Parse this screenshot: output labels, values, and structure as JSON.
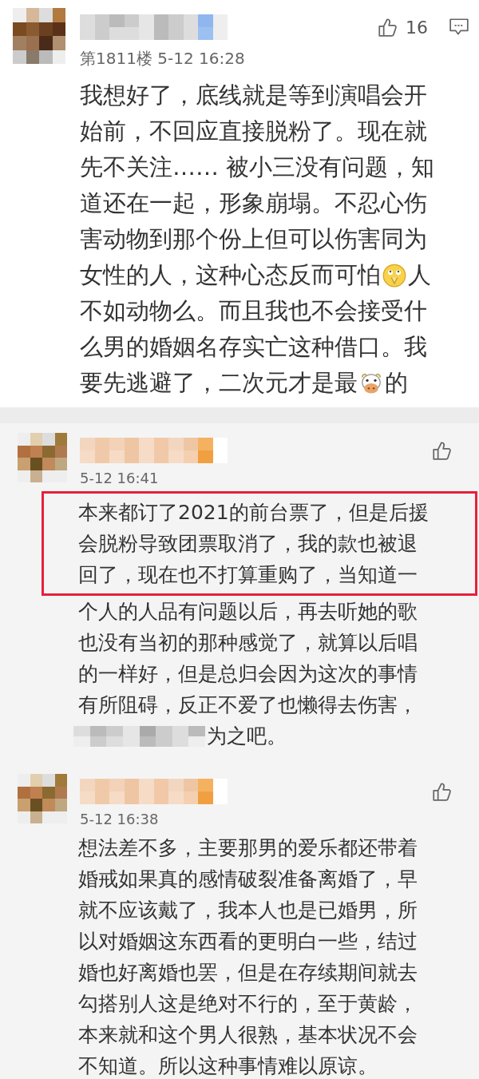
{
  "comments": [
    {
      "meta": "第1811楼 5-12 16:28",
      "like_count": "16",
      "has_reply": true,
      "lines": [
        {
          "highlighted": false,
          "parts": [
            {
              "kind": "text",
              "text": "我想好了，底线就是等到演唱会开"
            }
          ]
        },
        {
          "highlighted": false,
          "parts": [
            {
              "kind": "text",
              "text": "始前，不回应直接脱粉了。现在就"
            }
          ]
        },
        {
          "highlighted": false,
          "parts": [
            {
              "kind": "text",
              "text": "先不关注…… 被小三没有问题，知"
            }
          ]
        },
        {
          "highlighted": false,
          "parts": [
            {
              "kind": "text",
              "text": "道还在一起，形象崩塌。不忍心伤"
            }
          ]
        },
        {
          "highlighted": false,
          "parts": [
            {
              "kind": "text",
              "text": "害动物到那个份上但可以伤害同为"
            }
          ]
        },
        {
          "highlighted": false,
          "parts": [
            {
              "kind": "text",
              "text": "女性的人，这种心态反而可怕"
            },
            {
              "kind": "emoji_face"
            },
            {
              "kind": "text",
              "text": "人"
            }
          ]
        },
        {
          "highlighted": false,
          "parts": [
            {
              "kind": "text",
              "text": "不如动物么。而且我也不会接受什"
            }
          ]
        },
        {
          "highlighted": false,
          "parts": [
            {
              "kind": "text",
              "text": "么男的婚姻名存实亡这种借口。我"
            }
          ]
        },
        {
          "highlighted": false,
          "parts": [
            {
              "kind": "text",
              "text": "要先逃避了，二次元才是最"
            },
            {
              "kind": "emoji_cow"
            },
            {
              "kind": "text",
              "text": " 的"
            }
          ]
        }
      ]
    },
    {
      "meta": "5-12 16:41",
      "has_reply": false,
      "lines": [
        {
          "highlighted": true,
          "parts": [
            {
              "kind": "text",
              "text": "本来都订了2021的前台票了，但是后援"
            }
          ]
        },
        {
          "highlighted": true,
          "parts": [
            {
              "kind": "text",
              "text": "会脱粉导致团票取消了，我的款也被退"
            }
          ]
        },
        {
          "highlighted": true,
          "parts": [
            {
              "kind": "text",
              "text": "回了，现在也不打算重购了，当知道一"
            }
          ]
        },
        {
          "highlighted": false,
          "parts": [
            {
              "kind": "text",
              "text": "个人的人品有问题以后，再去听她的歌"
            }
          ]
        },
        {
          "highlighted": false,
          "parts": [
            {
              "kind": "text",
              "text": "也没有当初的那种感觉了，就算以后唱"
            }
          ]
        },
        {
          "highlighted": false,
          "parts": [
            {
              "kind": "text",
              "text": "的一样好，但是总归会因为这次的事情"
            }
          ]
        },
        {
          "highlighted": false,
          "parts": [
            {
              "kind": "text",
              "text": "有所阻碍，反正不爱了也懒得去伤害，"
            }
          ]
        },
        {
          "highlighted": false,
          "parts": [
            {
              "kind": "mosaic"
            },
            {
              "kind": "text",
              "text": "为之吧。"
            }
          ]
        }
      ]
    },
    {
      "meta": "5-12 16:38",
      "has_reply": false,
      "lines": [
        {
          "highlighted": false,
          "parts": [
            {
              "kind": "text",
              "text": "想法差不多，主要那男的爱乐都还带着"
            }
          ]
        },
        {
          "highlighted": false,
          "parts": [
            {
              "kind": "text",
              "text": "婚戒如果真的感情破裂准备离婚了，早"
            }
          ]
        },
        {
          "highlighted": false,
          "parts": [
            {
              "kind": "text",
              "text": "就不应该戴了，我本人也是已婚男，所"
            }
          ]
        },
        {
          "highlighted": false,
          "parts": [
            {
              "kind": "text",
              "text": "以对婚姻这东西看的更明白一些，结过"
            }
          ]
        },
        {
          "highlighted": false,
          "parts": [
            {
              "kind": "text",
              "text": "婚也好离婚也罢，但是在存续期间就去"
            }
          ]
        },
        {
          "highlighted": false,
          "parts": [
            {
              "kind": "text",
              "text": "勾搭别人这是绝对不行的，至于黄龄，"
            }
          ]
        },
        {
          "highlighted": false,
          "parts": [
            {
              "kind": "text",
              "text": "本来就和这个男人很熟，基本状况不会"
            }
          ]
        },
        {
          "highlighted": false,
          "parts": [
            {
              "kind": "text",
              "text": "不知道。所以这种事情难以原谅。"
            }
          ]
        }
      ]
    }
  ]
}
